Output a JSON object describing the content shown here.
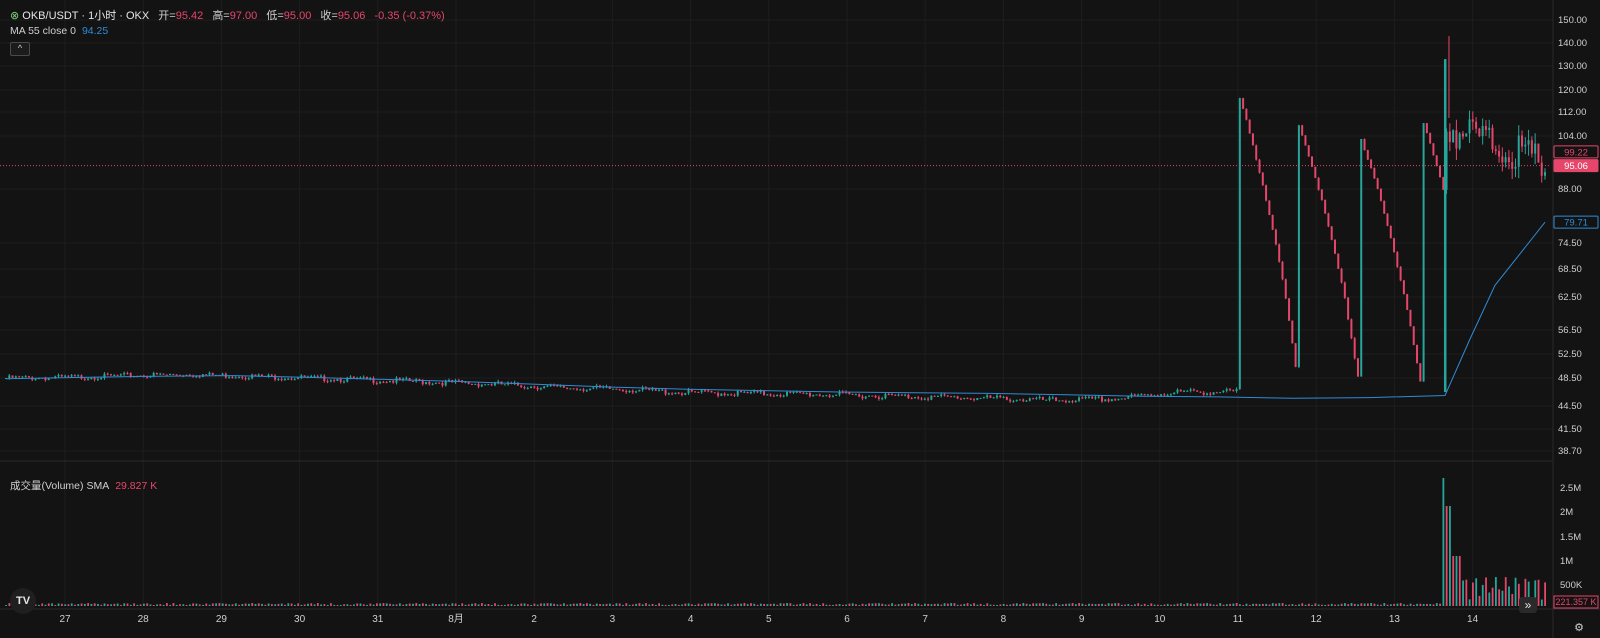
{
  "header": {
    "symbol": "OKB/USDT · 1小时 · OKX",
    "open_label": "开=",
    "open": "95.42",
    "high_label": "高=",
    "high": "97.00",
    "low_label": "低=",
    "low": "95.00",
    "close_label": "收=",
    "close": "95.06",
    "change": "-0.35 (-0.37%)"
  },
  "ma": {
    "label": "MA 55 close 0",
    "value": "94.25"
  },
  "volume_legend": {
    "label": "成交量(Volume)",
    "sma_label": "SMA",
    "value": "29.827 K"
  },
  "logo_text": "TV",
  "colors": {
    "up": "#26a69a",
    "down": "#e5466a",
    "ma": "#2f8bd6",
    "grid": "#1e1e1e",
    "bg": "#131313"
  },
  "chart_data": {
    "type": "candlestick",
    "price_axis_ticks": [
      "150.00",
      "140.00",
      "130.00",
      "120.00",
      "112.00",
      "104.00",
      "88.00",
      "74.50",
      "68.50",
      "62.50",
      "56.50",
      "52.50",
      "48.50",
      "44.50",
      "41.50",
      "38.70"
    ],
    "price_labels": {
      "ma_value": "79.71",
      "prev_close": "99.22",
      "last_price": "95.06"
    },
    "volume_axis_ticks": [
      "2.5M",
      "2M",
      "1.5M",
      "1M",
      "500K"
    ],
    "volume_last_label": "221.357 K",
    "time_axis_ticks": [
      "27",
      "28",
      "29",
      "30",
      "31",
      "8月",
      "2",
      "3",
      "4",
      "5",
      "6",
      "7",
      "8",
      "9",
      "10",
      "11",
      "12",
      "13",
      "14"
    ],
    "price_range": [
      38.7,
      150
    ],
    "series": [
      {
        "name": "OKB/USDT",
        "approx_close": [
          48.5,
          48.6,
          48.9,
          49.1,
          48.8,
          48.5,
          48.2,
          47.9,
          47.6,
          47.1,
          46.9,
          46.4,
          46.3,
          46.2,
          46.0,
          45.8,
          45.6,
          45.3,
          45.5,
          46.5,
          120.0,
          108.0,
          104.0,
          110.0,
          103.0,
          95.06
        ]
      },
      {
        "name": "MA 55 close 0",
        "approx": [
          48.4,
          48.6,
          48.8,
          48.9,
          48.6,
          48.3,
          48.0,
          47.6,
          47.2,
          46.9,
          46.7,
          46.5,
          46.4,
          46.3,
          46.1,
          45.9,
          45.8,
          45.6,
          45.7,
          46.0,
          55.0,
          65.0,
          72.0,
          79.71
        ]
      }
    ]
  }
}
